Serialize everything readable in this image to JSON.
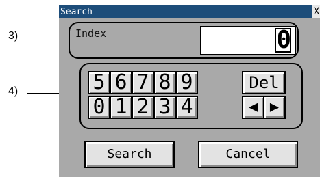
{
  "callouts": {
    "index_area": "3)",
    "keypad_area": "4)"
  },
  "window": {
    "title": "Search",
    "close_label": "X"
  },
  "index": {
    "label": "Index",
    "value": "0"
  },
  "keypad": {
    "row1": [
      "5",
      "6",
      "7",
      "8",
      "9"
    ],
    "row2": [
      "0",
      "1",
      "2",
      "3",
      "4"
    ],
    "delete_label": "Del",
    "left_arrow": "◀",
    "right_arrow": "▶"
  },
  "buttons": {
    "search_label": "Search",
    "cancel_label": "Cancel"
  },
  "colors": {
    "titlebar": "#1d4d7a",
    "window_bg": "#a9a9a9",
    "button_bg": "#e3e3e3"
  }
}
